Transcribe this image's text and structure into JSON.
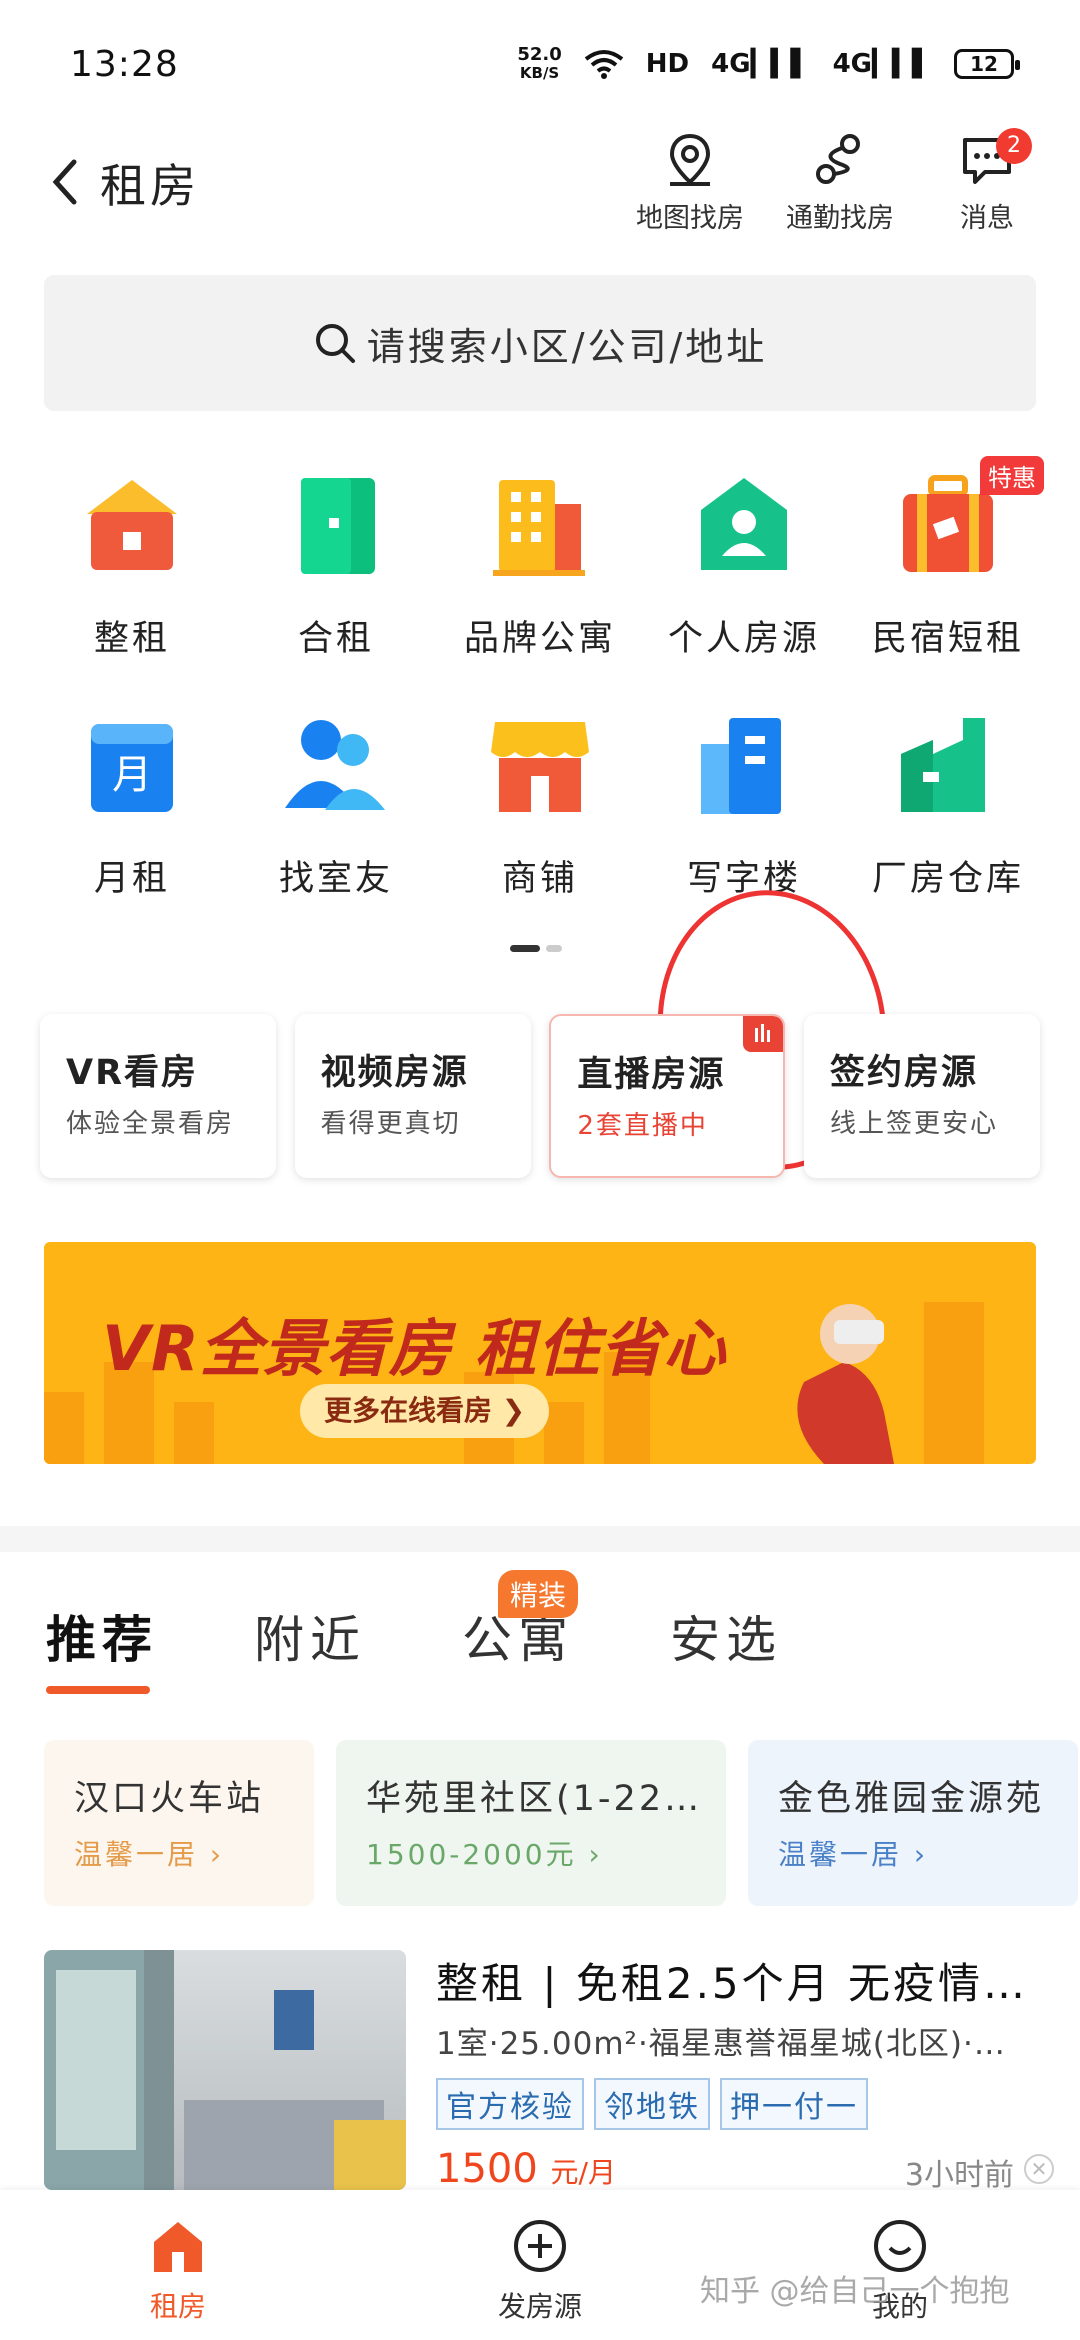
{
  "status_bar": {
    "time": "13:28",
    "speed_value": "52.0",
    "speed_unit": "KB/S",
    "hd": "HD",
    "sig1": "4G",
    "sig2": "4G",
    "battery": "12"
  },
  "header": {
    "title": "租房",
    "map_label": "地图找房",
    "commute_label": "通勤找房",
    "message_label": "消息",
    "message_badge": "2"
  },
  "search": {
    "placeholder": "请搜索小区/公司/地址"
  },
  "categories": [
    {
      "label": "整租",
      "icon": "house-icon"
    },
    {
      "label": "合租",
      "icon": "door-icon"
    },
    {
      "label": "品牌公寓",
      "icon": "building-icon"
    },
    {
      "label": "个人房源",
      "icon": "person-house-icon"
    },
    {
      "label": "民宿短租",
      "icon": "suitcase-icon",
      "badge": "特惠"
    },
    {
      "label": "月租",
      "icon": "calendar-icon",
      "icon_text": "月"
    },
    {
      "label": "找室友",
      "icon": "roommate-icon"
    },
    {
      "label": "商铺",
      "icon": "shop-icon"
    },
    {
      "label": "写字楼",
      "icon": "office-icon"
    },
    {
      "label": "厂房仓库",
      "icon": "factory-icon"
    }
  ],
  "feature_cards": [
    {
      "title": "VR看房",
      "subtitle": "体验全景看房"
    },
    {
      "title": "视频房源",
      "subtitle": "看得更真切"
    },
    {
      "title": "直播房源",
      "subtitle": "2套直播中"
    },
    {
      "title": "签约房源",
      "subtitle": "线上签更安心"
    }
  ],
  "banner": {
    "headline": "VR全景看房 租住省心",
    "button": "更多在线看房"
  },
  "tabs": [
    {
      "label": "推荐"
    },
    {
      "label": "附近"
    },
    {
      "label": "公寓",
      "badge": "精装"
    },
    {
      "label": "安选"
    }
  ],
  "chips": [
    {
      "title": "汉口火车站",
      "sub": "温馨一居",
      "bg": "#fcf6ef",
      "color": "#e49b4a"
    },
    {
      "title": "华苑里社区(1-22…",
      "sub": "1500-2000元",
      "bg": "#eff5ef",
      "color": "#6aa86a"
    },
    {
      "title": "金色雅园金源苑",
      "sub": "温馨一居",
      "bg": "#eef4fb",
      "color": "#4a80c8"
    }
  ],
  "listing": {
    "title": "整租 | 免租2.5个月 无疫情…",
    "subtitle": "1室·25.00m²·福星惠誉福星城(北区)·…",
    "tags": [
      "官方核验",
      "邻地铁",
      "押一付一"
    ],
    "price": "1500",
    "price_unit": "元/月",
    "time_ago": "3小时前"
  },
  "bottom_nav": [
    {
      "label": "租房",
      "active": true
    },
    {
      "label": "发房源"
    },
    {
      "label": "我的"
    }
  ],
  "watermark": "知乎 @给自己一个抱抱",
  "colors": {
    "accent": "#f0592a",
    "red": "#e84335",
    "search_bg": "#f2f2f2",
    "banner_bg": "#fdb414"
  }
}
